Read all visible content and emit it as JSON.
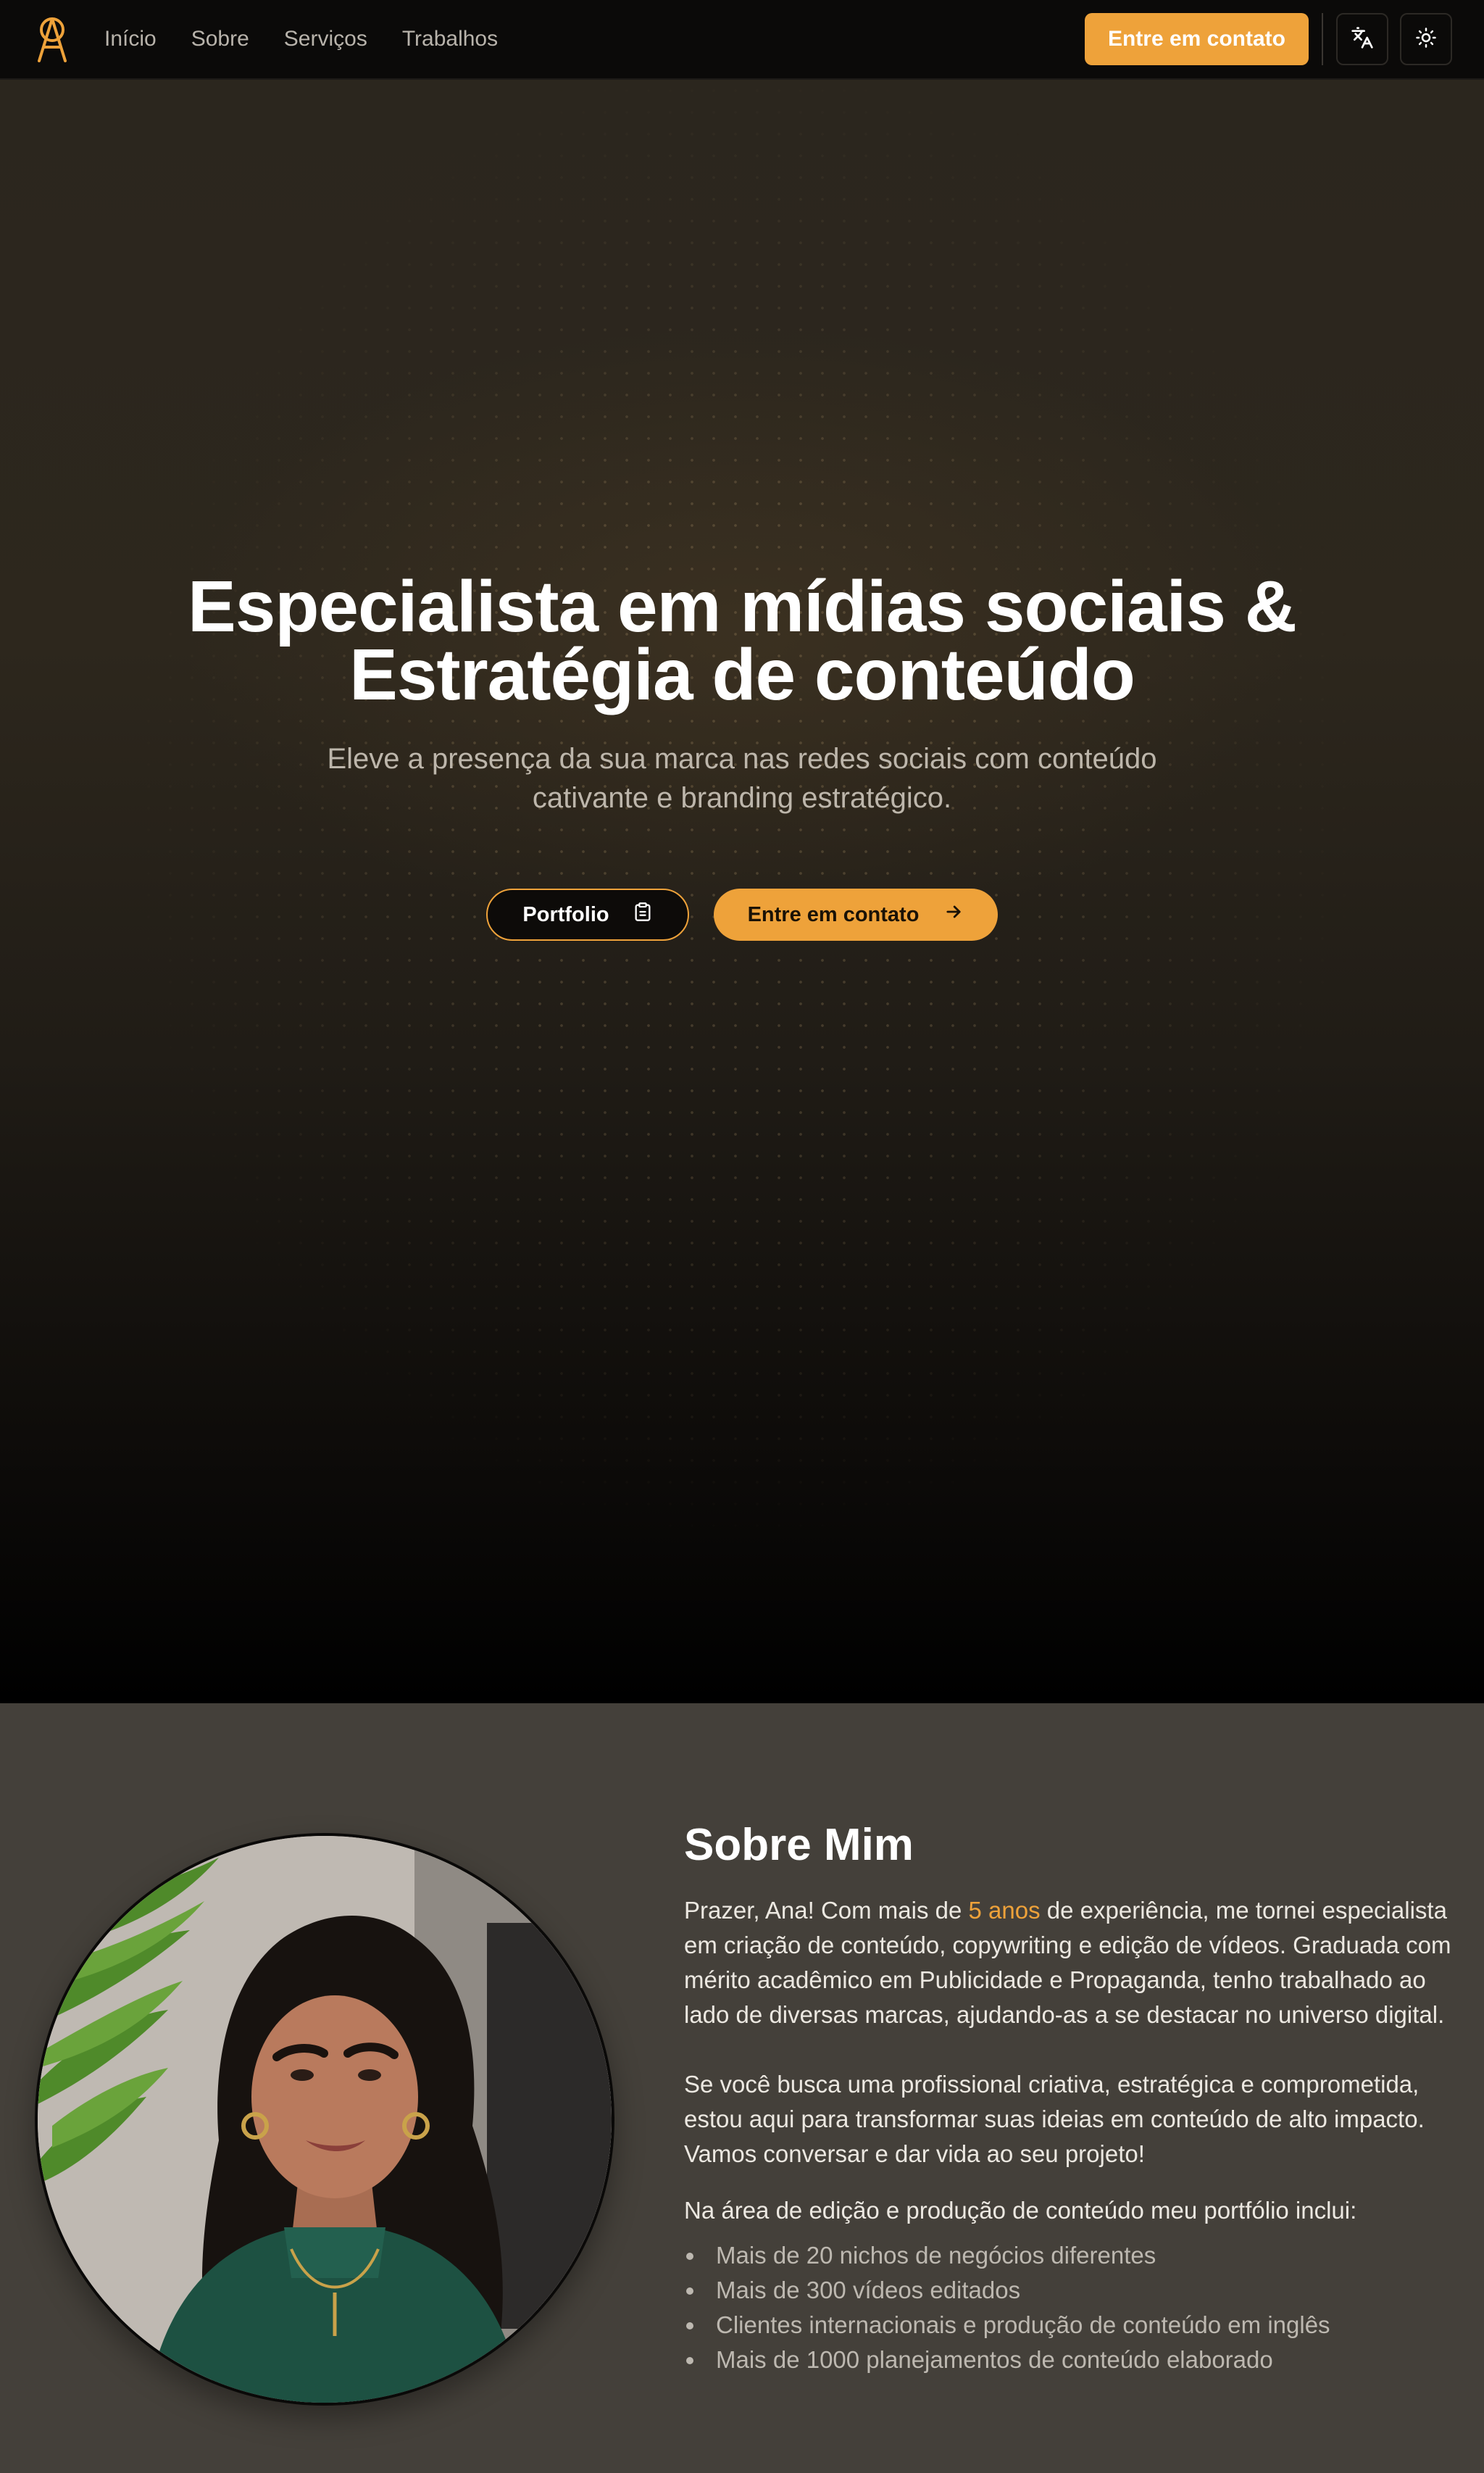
{
  "colors": {
    "accent": "#eea23a",
    "nav_bg": "#0b0a09",
    "about_bg": "#44403a"
  },
  "nav": {
    "logo_icon": "a-monogram-icon",
    "links": [
      "Início",
      "Sobre",
      "Serviços",
      "Trabalhos"
    ],
    "contact_label": "Entre em contato",
    "translate_icon": "translate-icon",
    "theme_icon": "sun-icon"
  },
  "hero": {
    "title_line1": "Especialista em mídias sociais &",
    "title_line2": "Estratégia de conteúdo",
    "subtitle": "Eleve a presença da sua marca nas redes sociais com conteúdo cativante e branding estratégico.",
    "portfolio_label": "Portfolio",
    "portfolio_icon": "clipboard-icon",
    "contact_label": "Entre em contato",
    "contact_icon": "arrow-right-icon"
  },
  "about": {
    "title": "Sobre Mim",
    "p1_before": "Prazer, Ana! Com mais de ",
    "p1_highlight": "5 anos",
    "p1_after": " de experiência, me tornei especialista em criação de conteúdo, copywriting e edição de vídeos. Graduada com mérito acadêmico em Publicidade e Propaganda, tenho trabalhado ao lado de diversas marcas, ajudando-as a se destacar no universo digital.",
    "p2": "Se você busca uma profissional criativa, estratégica e comprometida, estou aqui para transformar suas ideias em conteúdo de alto impacto. Vamos conversar e dar vida ao seu projeto!",
    "list_intro": "Na área de edição e produção de conteúdo meu portfólio inclui:",
    "list": [
      "Mais de 20 nichos de negócios diferentes",
      "Mais de 300 vídeos editados",
      "Clientes internacionais e produção de conteúdo em inglês",
      "Mais de 1000 planejamentos de conteúdo elaborado"
    ]
  }
}
